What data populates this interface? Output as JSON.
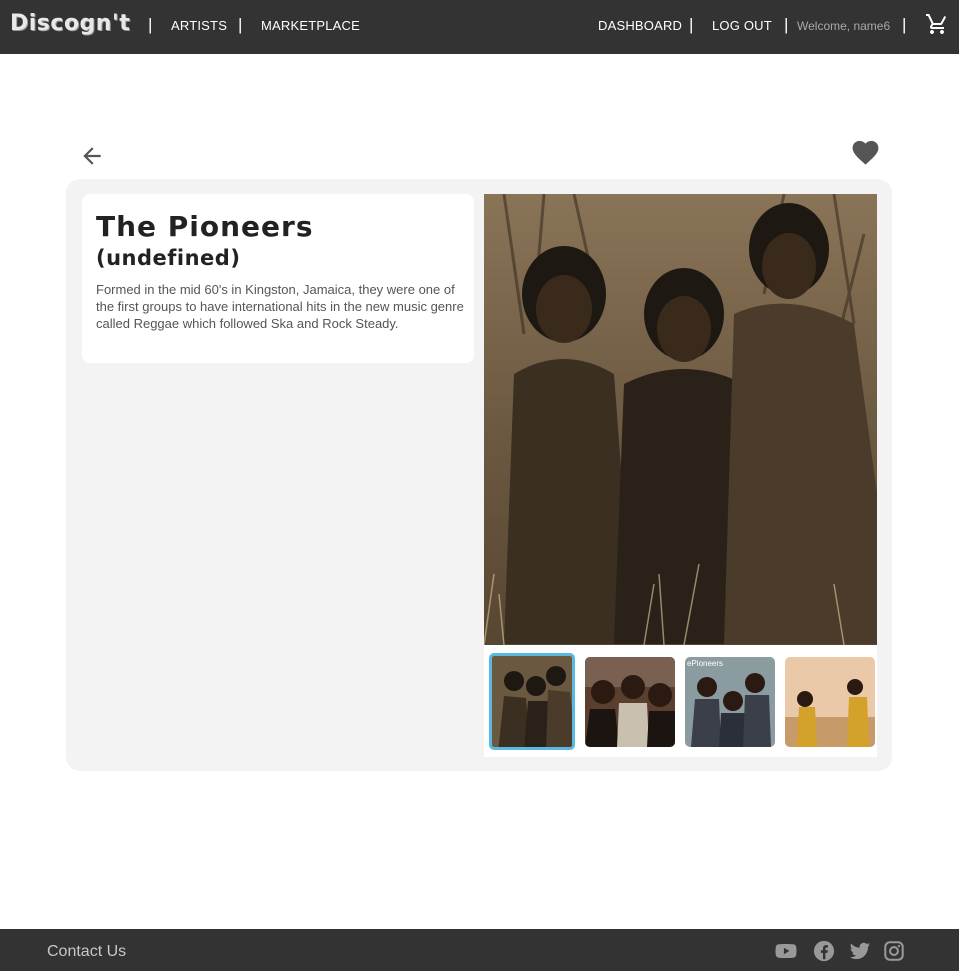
{
  "nav": {
    "logo": "Discogn't",
    "separator": "|",
    "artists": "ARTISTS",
    "marketplace": "MARKETPLACE",
    "dashboard": "DASHBOARD",
    "logout": "LOG OUT",
    "welcome": "Welcome, name6"
  },
  "artist": {
    "name": "The Pioneers",
    "subtitle": "(undefined)",
    "bio": "Formed in the mid 60's in Kingston, Jamaica, they were one of the first groups to have international hits in the new music genre called Reggae which followed Ska and Rock Steady."
  },
  "gallery": {
    "thumbnail_count": 4,
    "selected_index": 0,
    "thumb3_caption": "ePioneers"
  },
  "footer": {
    "contact": "Contact Us"
  },
  "icons": {
    "back": "arrow-left-icon",
    "favorite": "heart-icon",
    "cart": "shopping-cart-icon",
    "social": [
      "youtube-icon",
      "facebook-icon",
      "twitter-icon",
      "instagram-icon"
    ]
  },
  "colors": {
    "navbar": "#333333",
    "panel": "#f3f3f3",
    "selected_thumb_border": "#5bb8e0"
  }
}
